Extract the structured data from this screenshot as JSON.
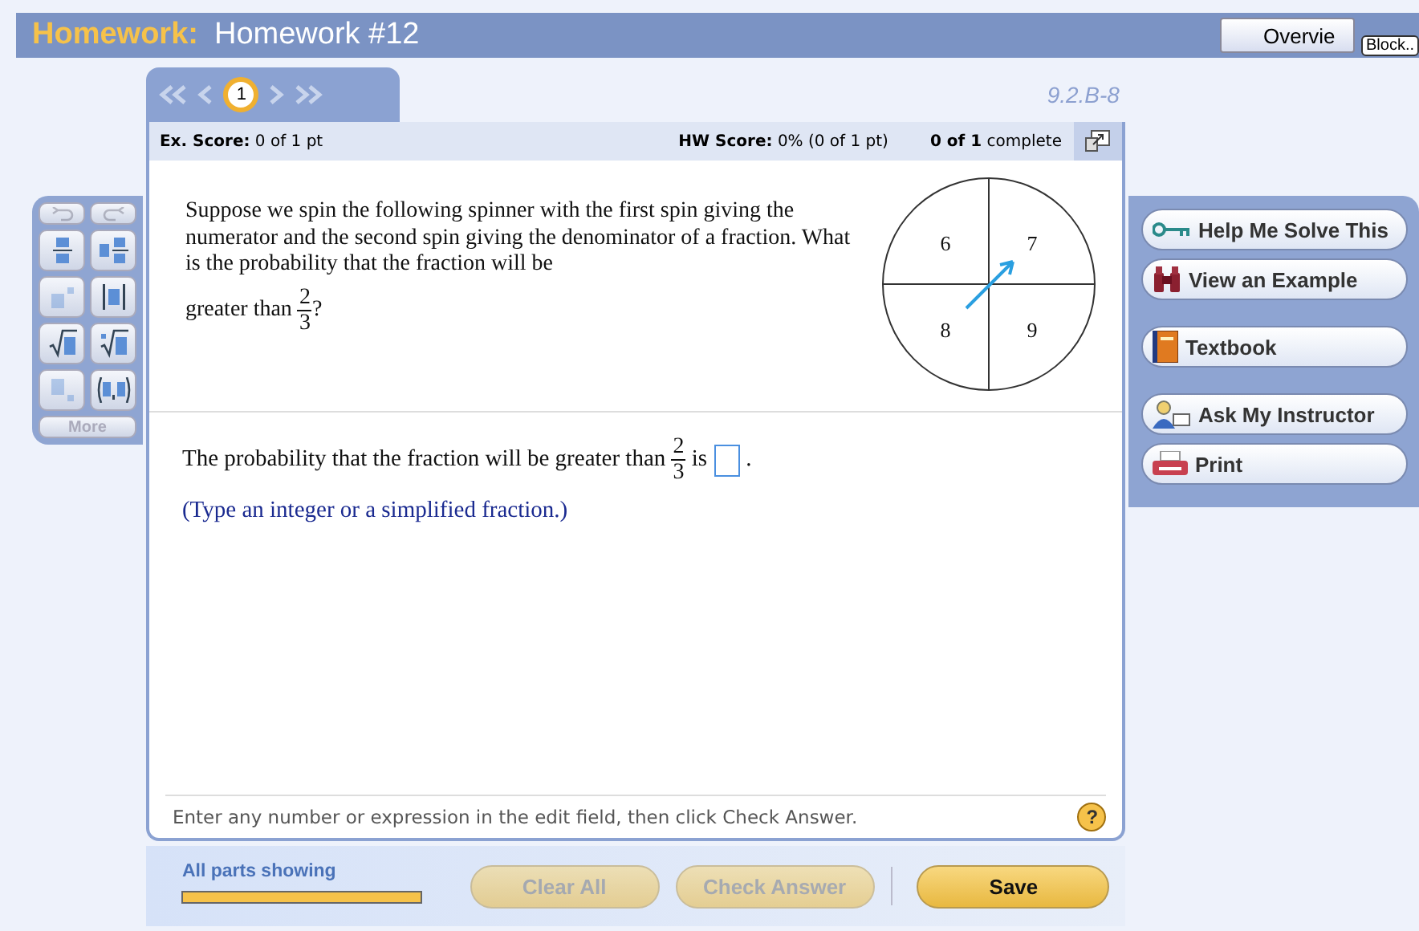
{
  "header": {
    "label": "Homework:",
    "title": "Homework #12",
    "overview_button": "Overvie",
    "tooltip": "Block.."
  },
  "navigation": {
    "pages": [
      {
        "label": "1",
        "selected": true
      }
    ],
    "problem_id": "9.2.B-8"
  },
  "score_bar": {
    "ex_label": "Ex. Score:",
    "ex_value": "0 of 1 pt",
    "hw_label": "HW Score:",
    "hw_value": "0% (0 of 1 pt)",
    "progress_bold": "0 of 1",
    "progress_text": "complete"
  },
  "palette": [
    {
      "kind": "undo",
      "disabled": true
    },
    {
      "kind": "redo",
      "disabled": true
    },
    {
      "kind": "fraction",
      "disabled": false
    },
    {
      "kind": "mixed",
      "disabled": false
    },
    {
      "kind": "exponent",
      "disabled": true
    },
    {
      "kind": "absolute",
      "disabled": false
    },
    {
      "kind": "sqrt",
      "disabled": false
    },
    {
      "kind": "nthroot",
      "disabled": false
    },
    {
      "kind": "subscript",
      "disabled": true
    },
    {
      "kind": "interval",
      "disabled": false
    },
    {
      "kind": "more",
      "label": "More",
      "disabled": true
    }
  ],
  "question": {
    "text": "Suppose we spin the following spinner with the first spin giving the numerator and the second spin giving the denominator of a fraction.  What is the probability that the fraction will be",
    "last_words": "greater than",
    "numerator": "2",
    "denominator": "3",
    "end": "?"
  },
  "spinner": {
    "sectors": [
      "6",
      "7",
      "8",
      "9"
    ]
  },
  "answer": {
    "before": "The probability that the fraction will be greater than",
    "numerator": "2",
    "denominator": "3",
    "is": "is",
    "end": ".",
    "instruction": "(Type an integer or a simplified fraction.)"
  },
  "hint": "Enter any number or expression in the edit field, then click Check Answer.",
  "help_icon": "?",
  "tools": [
    {
      "kind": "key",
      "label": "Help Me Solve This"
    },
    {
      "kind": "example",
      "label": "View an Example"
    },
    {
      "kind": "book",
      "label": "Textbook"
    },
    {
      "kind": "instructor",
      "label": "Ask My Instructor"
    },
    {
      "kind": "print",
      "label": "Print"
    }
  ],
  "footer": {
    "parts_label": "All parts showing",
    "level": 1,
    "buttons": [
      {
        "label": "Clear All",
        "disabled": true
      },
      {
        "label": "Check Answer",
        "disabled": true
      },
      {
        "label": "Save",
        "disabled": false
      }
    ]
  }
}
